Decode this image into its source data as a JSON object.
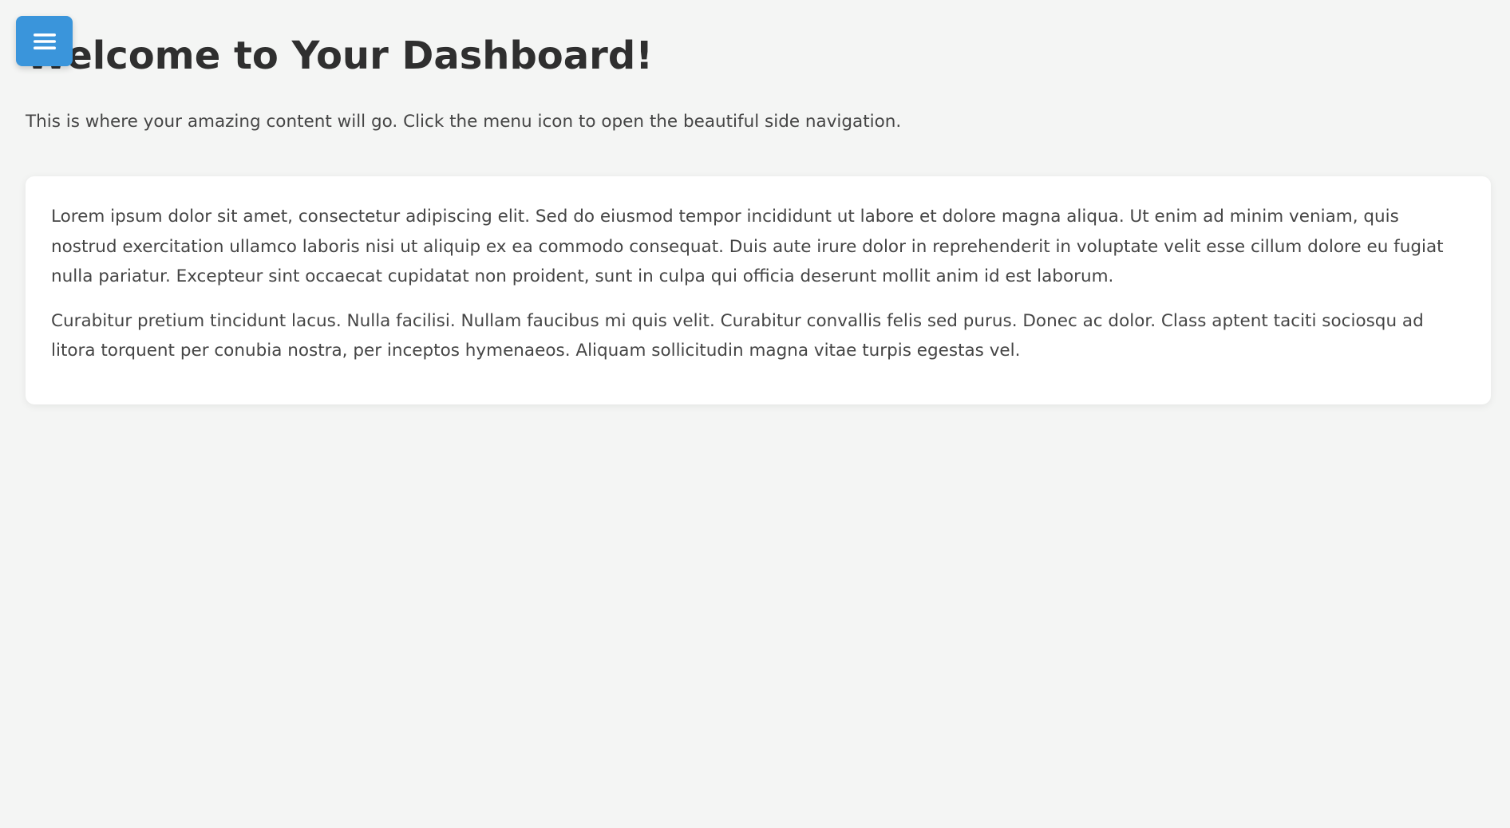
{
  "menu": {
    "icon": "hamburger-menu-icon",
    "color": "#3a95db"
  },
  "main": {
    "title": "Welcome to Your Dashboard!",
    "intro": "This is where your amazing content will go. Click the menu icon to open the beautiful side navigation.",
    "card": {
      "paragraphs": [
        "Lorem ipsum dolor sit amet, consectetur adipiscing elit. Sed do eiusmod tempor incididunt ut labore et dolore magna aliqua. Ut enim ad minim veniam, quis nostrud exercitation ullamco laboris nisi ut aliquip ex ea commodo consequat. Duis aute irure dolor in reprehenderit in voluptate velit esse cillum dolore eu fugiat nulla pariatur. Excepteur sint occaecat cupidatat non proident, sunt in culpa qui officia deserunt mollit anim id est laborum.",
        "Curabitur pretium tincidunt lacus. Nulla facilisi. Nullam faucibus mi quis velit. Curabitur convallis felis sed purus. Donec ac dolor. Class aptent taciti sociosqu ad litora torquent per conubia nostra, per inceptos hymenaeos. Aliquam sollicitudin magna vitae turpis egestas vel."
      ]
    }
  },
  "colors": {
    "background": "#f4f5f4",
    "text": "#454545",
    "heading": "#2f2f2f",
    "card": "#ffffff"
  }
}
